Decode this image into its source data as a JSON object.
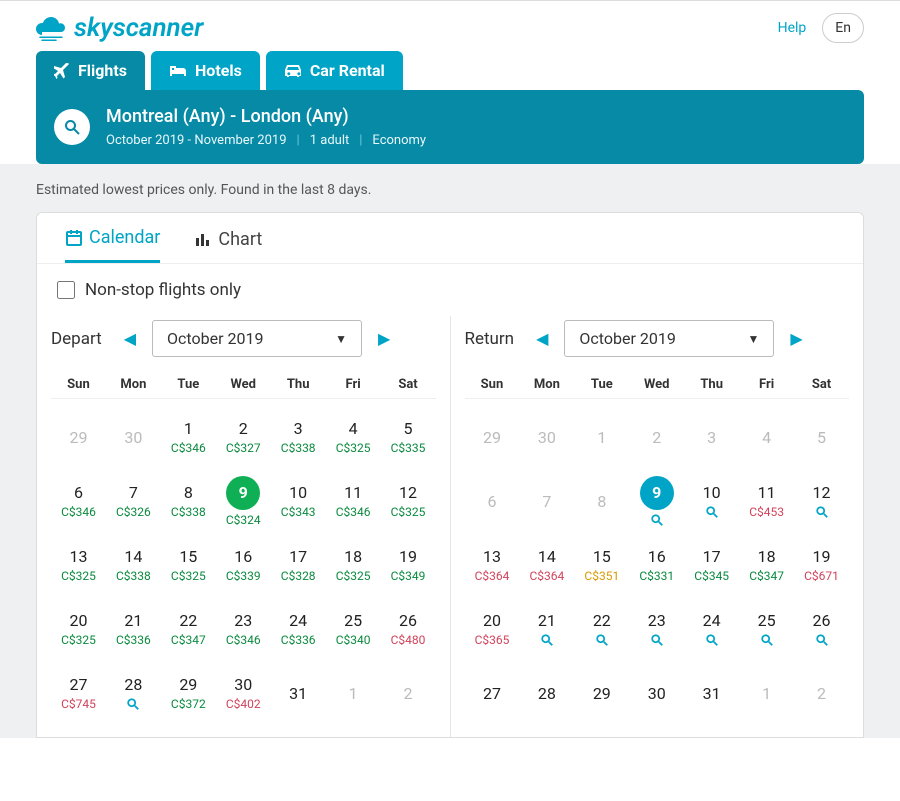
{
  "brand": "skyscanner",
  "top": {
    "help": "Help",
    "locale": "En"
  },
  "nav": {
    "flights": "Flights",
    "hotels": "Hotels",
    "car": "Car Rental"
  },
  "summary": {
    "route": "Montreal (Any) - London (Any)",
    "dates": "October 2019 - November 2019",
    "pax": "1 adult",
    "cabin": "Economy"
  },
  "disclaimer": "Estimated lowest prices only. Found in the last 8 days.",
  "view": {
    "calendar": "Calendar",
    "chart": "Chart"
  },
  "nonstop_label": "Non-stop flights only",
  "dow": [
    "Sun",
    "Mon",
    "Tue",
    "Wed",
    "Thu",
    "Fri",
    "Sat"
  ],
  "depart": {
    "label": "Depart",
    "month": "October 2019"
  },
  "return": {
    "label": "Return",
    "month": "October 2019"
  },
  "depart_cells": [
    {
      "d": "29",
      "muted": true
    },
    {
      "d": "30",
      "muted": true
    },
    {
      "d": "1",
      "p": "C$346",
      "c": "g"
    },
    {
      "d": "2",
      "p": "C$327",
      "c": "g"
    },
    {
      "d": "3",
      "p": "C$338",
      "c": "g"
    },
    {
      "d": "4",
      "p": "C$325",
      "c": "g"
    },
    {
      "d": "5",
      "p": "C$335",
      "c": "g"
    },
    {
      "d": "6",
      "p": "C$346",
      "c": "g"
    },
    {
      "d": "7",
      "p": "C$326",
      "c": "g"
    },
    {
      "d": "8",
      "p": "C$338",
      "c": "g"
    },
    {
      "d": "9",
      "p": "C$324",
      "c": "g",
      "sel": "g"
    },
    {
      "d": "10",
      "p": "C$343",
      "c": "g"
    },
    {
      "d": "11",
      "p": "C$346",
      "c": "g"
    },
    {
      "d": "12",
      "p": "C$325",
      "c": "g"
    },
    {
      "d": "13",
      "p": "C$325",
      "c": "g"
    },
    {
      "d": "14",
      "p": "C$338",
      "c": "g"
    },
    {
      "d": "15",
      "p": "C$325",
      "c": "g"
    },
    {
      "d": "16",
      "p": "C$339",
      "c": "g"
    },
    {
      "d": "17",
      "p": "C$328",
      "c": "g"
    },
    {
      "d": "18",
      "p": "C$325",
      "c": "g"
    },
    {
      "d": "19",
      "p": "C$349",
      "c": "g"
    },
    {
      "d": "20",
      "p": "C$325",
      "c": "g"
    },
    {
      "d": "21",
      "p": "C$336",
      "c": "g"
    },
    {
      "d": "22",
      "p": "C$347",
      "c": "g"
    },
    {
      "d": "23",
      "p": "C$346",
      "c": "g"
    },
    {
      "d": "24",
      "p": "C$336",
      "c": "g"
    },
    {
      "d": "25",
      "p": "C$340",
      "c": "g"
    },
    {
      "d": "26",
      "p": "C$480",
      "c": "r"
    },
    {
      "d": "27",
      "p": "C$745",
      "c": "r"
    },
    {
      "d": "28",
      "mag": true
    },
    {
      "d": "29",
      "p": "C$372",
      "c": "g"
    },
    {
      "d": "30",
      "p": "C$402",
      "c": "r"
    },
    {
      "d": "31"
    },
    {
      "d": "1",
      "muted": true
    },
    {
      "d": "2",
      "muted": true
    }
  ],
  "return_cells": [
    {
      "d": "29",
      "muted": true
    },
    {
      "d": "30",
      "muted": true
    },
    {
      "d": "1",
      "muted": true
    },
    {
      "d": "2",
      "muted": true
    },
    {
      "d": "3",
      "muted": true
    },
    {
      "d": "4",
      "muted": true
    },
    {
      "d": "5",
      "muted": true
    },
    {
      "d": "6",
      "muted": true
    },
    {
      "d": "7",
      "muted": true
    },
    {
      "d": "8",
      "muted": true
    },
    {
      "d": "9",
      "sel": "b",
      "mag": true
    },
    {
      "d": "10",
      "mag": true
    },
    {
      "d": "11",
      "p": "C$453",
      "c": "r"
    },
    {
      "d": "12",
      "mag": true
    },
    {
      "d": "13",
      "p": "C$364",
      "c": "r"
    },
    {
      "d": "14",
      "p": "C$364",
      "c": "r"
    },
    {
      "d": "15",
      "p": "C$351",
      "c": "y"
    },
    {
      "d": "16",
      "p": "C$331",
      "c": "g"
    },
    {
      "d": "17",
      "p": "C$345",
      "c": "g"
    },
    {
      "d": "18",
      "p": "C$347",
      "c": "g"
    },
    {
      "d": "19",
      "p": "C$671",
      "c": "r"
    },
    {
      "d": "20",
      "p": "C$365",
      "c": "r"
    },
    {
      "d": "21",
      "mag": true
    },
    {
      "d": "22",
      "mag": true
    },
    {
      "d": "23",
      "mag": true
    },
    {
      "d": "24",
      "mag": true
    },
    {
      "d": "25",
      "mag": true
    },
    {
      "d": "26",
      "mag": true
    },
    {
      "d": "27"
    },
    {
      "d": "28"
    },
    {
      "d": "29"
    },
    {
      "d": "30"
    },
    {
      "d": "31"
    },
    {
      "d": "1",
      "muted": true
    },
    {
      "d": "2",
      "muted": true
    }
  ]
}
